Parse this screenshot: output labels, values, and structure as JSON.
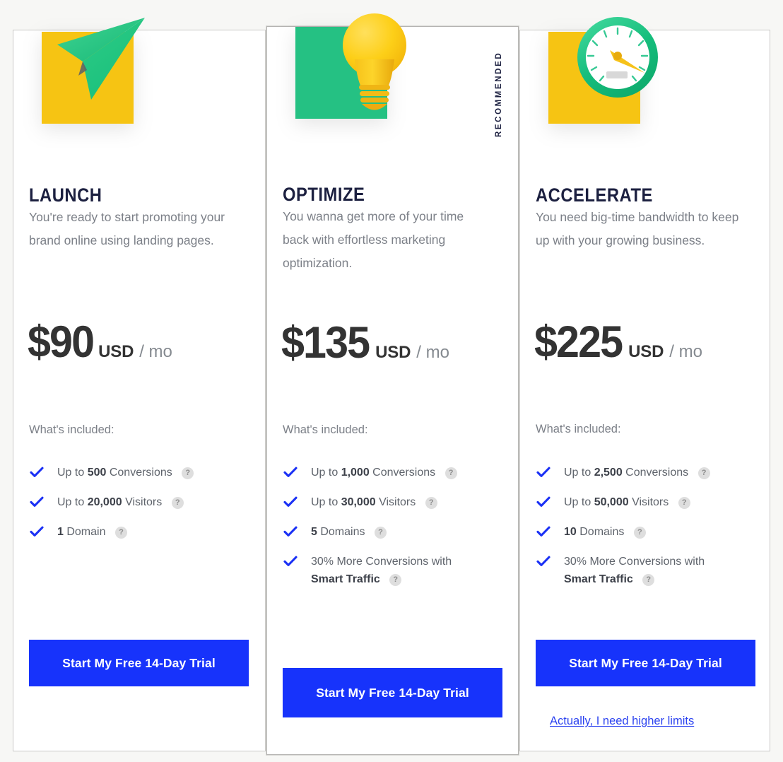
{
  "theme": {
    "page_background": "#f7f7f5",
    "card_background": "#ffffff",
    "card_border": "#c9c8c6",
    "accent_blue": "#1733fb",
    "link_blue": "#2c43f0",
    "check_blue": "#1b31f5",
    "title_navy": "#1c2040",
    "body_gray": "#7c8088",
    "price_gray": "#333333",
    "swatch_yellow": "#f6c413",
    "swatch_green": "#25c183",
    "help_bubble_gray": "#dedede"
  },
  "labels": {
    "included": "What's included:",
    "help": "?",
    "recommended_ribbon": "RECOMMENDED"
  },
  "plans": [
    {
      "id": "launch",
      "name": "LAUNCH",
      "icon": "paper-plane-icon",
      "icon_swatch_color": "#f6c413",
      "description": "You're ready to start promoting your brand online using landing pages.",
      "price": {
        "amount": "$90",
        "currency": "USD",
        "period": "/ mo"
      },
      "included_label": "What's included:",
      "features": [
        {
          "prefix": "Up to ",
          "value": "500",
          "suffix": " Conversions",
          "bold_second_line": null,
          "help": "?"
        },
        {
          "prefix": "Up to ",
          "value": "20,000",
          "suffix": " Visitors",
          "bold_second_line": null,
          "help": "?"
        },
        {
          "prefix": "",
          "value": "1",
          "suffix": " Domain",
          "bold_second_line": null,
          "help": "?"
        }
      ],
      "cta": "Start My Free 14-Day Trial",
      "upsell_link": null,
      "recommended": false
    },
    {
      "id": "optimize",
      "name": "OPTIMIZE",
      "icon": "lightbulb-icon",
      "icon_swatch_color": "#25c183",
      "description": "You wanna get more of your time back with effortless marketing optimization.",
      "price": {
        "amount": "$135",
        "currency": "USD",
        "period": "/ mo"
      },
      "included_label": "What's included:",
      "features": [
        {
          "prefix": "Up to ",
          "value": "1,000",
          "suffix": " Conversions",
          "bold_second_line": null,
          "help": "?"
        },
        {
          "prefix": "Up to ",
          "value": "30,000",
          "suffix": " Visitors",
          "bold_second_line": null,
          "help": "?"
        },
        {
          "prefix": "",
          "value": "5",
          "suffix": " Domains",
          "bold_second_line": null,
          "help": "?"
        },
        {
          "prefix": "",
          "value": "",
          "suffix": "30% More Conversions with",
          "bold_second_line": "Smart Traffic",
          "help": "?"
        }
      ],
      "cta": "Start My Free 14-Day Trial",
      "upsell_link": null,
      "recommended": true
    },
    {
      "id": "accelerate",
      "name": "ACCELERATE",
      "icon": "speedometer-icon",
      "icon_swatch_color": "#f6c413",
      "description": "You need big-time bandwidth to keep up with your growing business.",
      "price": {
        "amount": "$225",
        "currency": "USD",
        "period": "/ mo"
      },
      "included_label": "What's included:",
      "features": [
        {
          "prefix": "Up to ",
          "value": "2,500",
          "suffix": " Conversions",
          "bold_second_line": null,
          "help": "?"
        },
        {
          "prefix": "Up to ",
          "value": "50,000",
          "suffix": " Visitors",
          "bold_second_line": null,
          "help": "?"
        },
        {
          "prefix": "",
          "value": "10",
          "suffix": " Domains",
          "bold_second_line": null,
          "help": "?"
        },
        {
          "prefix": "",
          "value": "",
          "suffix": "30% More Conversions with",
          "bold_second_line": "Smart Traffic",
          "help": "?"
        }
      ],
      "cta": "Start My Free 14-Day Trial",
      "upsell_link": "Actually, I need higher limits",
      "recommended": false
    }
  ]
}
